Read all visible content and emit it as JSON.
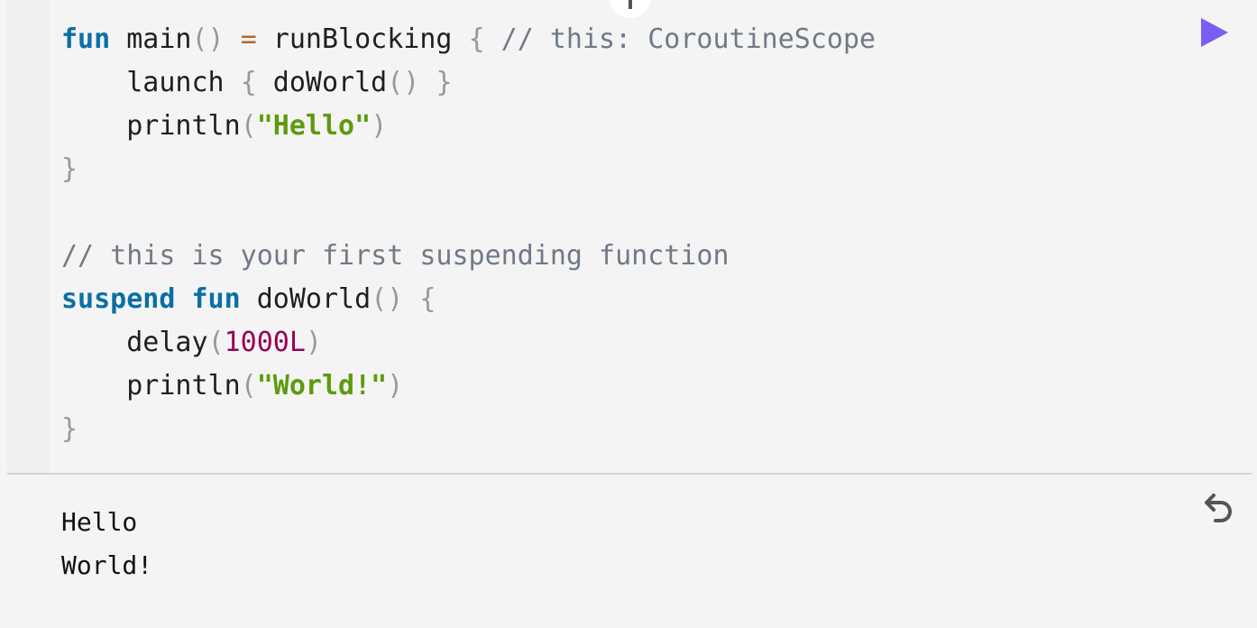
{
  "editor": {
    "lines": [
      [
        {
          "t": "fun",
          "c": "kw"
        },
        {
          "t": " main",
          "c": "fn"
        },
        {
          "t": "()",
          "c": "p"
        },
        {
          "t": " ",
          "c": "fn"
        },
        {
          "t": "=",
          "c": "op"
        },
        {
          "t": " runBlocking ",
          "c": "fn"
        },
        {
          "t": "{",
          "c": "p"
        },
        {
          "t": " // this: CoroutineScope",
          "c": "cm"
        }
      ],
      [
        {
          "t": "    launch ",
          "c": "fn"
        },
        {
          "t": "{",
          "c": "p"
        },
        {
          "t": " doWorld",
          "c": "fn"
        },
        {
          "t": "()",
          "c": "p"
        },
        {
          "t": " ",
          "c": "fn"
        },
        {
          "t": "}",
          "c": "p"
        }
      ],
      [
        {
          "t": "    println",
          "c": "fn"
        },
        {
          "t": "(",
          "c": "p"
        },
        {
          "t": "\"Hello\"",
          "c": "str"
        },
        {
          "t": ")",
          "c": "p"
        }
      ],
      [
        {
          "t": "}",
          "c": "p"
        }
      ],
      [],
      [
        {
          "t": "// this is your first suspending function",
          "c": "cm"
        }
      ],
      [
        {
          "t": "suspend",
          "c": "kw"
        },
        {
          "t": " ",
          "c": "fn"
        },
        {
          "t": "fun",
          "c": "kw"
        },
        {
          "t": " doWorld",
          "c": "fn"
        },
        {
          "t": "()",
          "c": "p"
        },
        {
          "t": " ",
          "c": "fn"
        },
        {
          "t": "{",
          "c": "p"
        }
      ],
      [
        {
          "t": "    delay",
          "c": "fn"
        },
        {
          "t": "(",
          "c": "p"
        },
        {
          "t": "1000L",
          "c": "num"
        },
        {
          "t": ")",
          "c": "p"
        }
      ],
      [
        {
          "t": "    println",
          "c": "fn"
        },
        {
          "t": "(",
          "c": "p"
        },
        {
          "t": "\"World!\"",
          "c": "str"
        },
        {
          "t": ")",
          "c": "p"
        }
      ],
      [
        {
          "t": "}",
          "c": "p"
        }
      ]
    ],
    "run_icon": "play-icon",
    "run_color": "#7b5cf5"
  },
  "output": {
    "lines": [
      "Hello",
      "World!"
    ],
    "reset_icon": "undo-icon"
  }
}
